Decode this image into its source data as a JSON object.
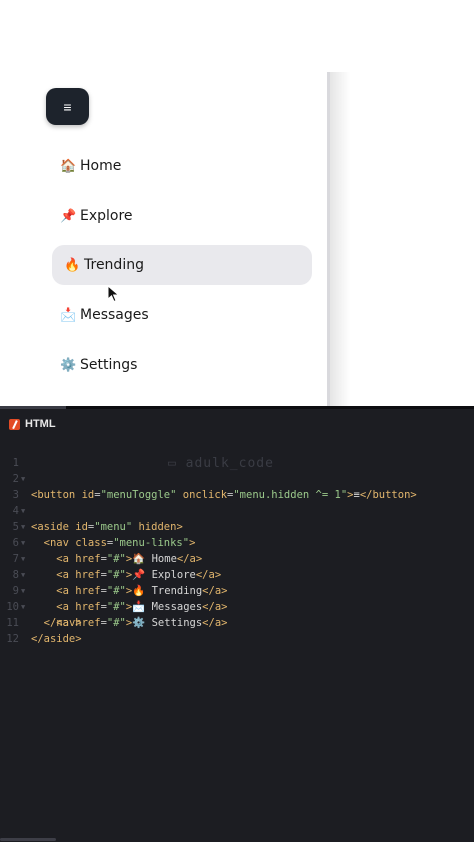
{
  "preview": {
    "toggle_label": "≡",
    "nav": [
      {
        "emoji": "🏠",
        "label": "Home",
        "active": false
      },
      {
        "emoji": "📌",
        "label": "Explore",
        "active": false
      },
      {
        "emoji": "🔥",
        "label": "Trending",
        "active": true
      },
      {
        "emoji": "📩",
        "label": "Messages",
        "active": false
      },
      {
        "emoji": "⚙️",
        "label": "Settings",
        "active": false
      }
    ]
  },
  "editor": {
    "title": "HTML",
    "watermark": "▭ adulk_code",
    "line_numbers": [
      "1",
      "2",
      "3",
      "4",
      "5",
      "6",
      "7",
      "8",
      "9",
      "10",
      "11",
      "12"
    ]
  },
  "colors": {
    "editor_bg": "#1c1d22",
    "toggle_bg": "#1d232c",
    "active_item_bg": "#e9e9ed",
    "tag_color": "#e2b66d",
    "string_color": "#9bc98b"
  }
}
